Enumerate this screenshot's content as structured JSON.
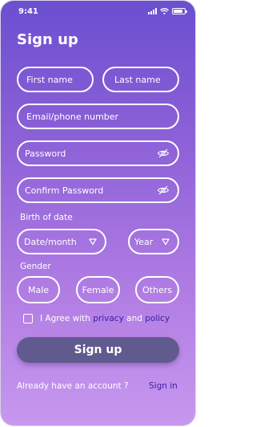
{
  "status_bar": {
    "time": "9:41",
    "icons": [
      "signal-icon",
      "wifi-icon",
      "battery-icon"
    ]
  },
  "title": "Sign up",
  "fields": {
    "first_name": {
      "placeholder": "First name"
    },
    "last_name": {
      "placeholder": "Last name"
    },
    "email": {
      "placeholder": "Email/phone number"
    },
    "password": {
      "placeholder": "Password",
      "icon": "eye-off-icon"
    },
    "confirm_password": {
      "placeholder": "Confirm Password",
      "icon": "eye-off-icon"
    }
  },
  "birth": {
    "label": "Birth of date",
    "date_month": {
      "value": "Date/month",
      "icon": "triangle-down-icon"
    },
    "year": {
      "value": "Year",
      "icon": "triangle-down-icon"
    }
  },
  "gender": {
    "label": "Gender",
    "options": [
      "Male",
      "Female",
      "Others"
    ]
  },
  "agree": {
    "prefix": "I Agree with ",
    "privacy": "privacy",
    "and": " and ",
    "policy": "policy",
    "checked": false
  },
  "signup_button": "Sign up",
  "footer": {
    "question": "Already have an account ?",
    "signin_link": "Sign in"
  },
  "colors": {
    "gradient_top": "#6b4fd0",
    "gradient_bottom": "#c898ef",
    "button_bg": "#615a8e",
    "link": "#3a1ea8",
    "text": "#ffffff"
  }
}
